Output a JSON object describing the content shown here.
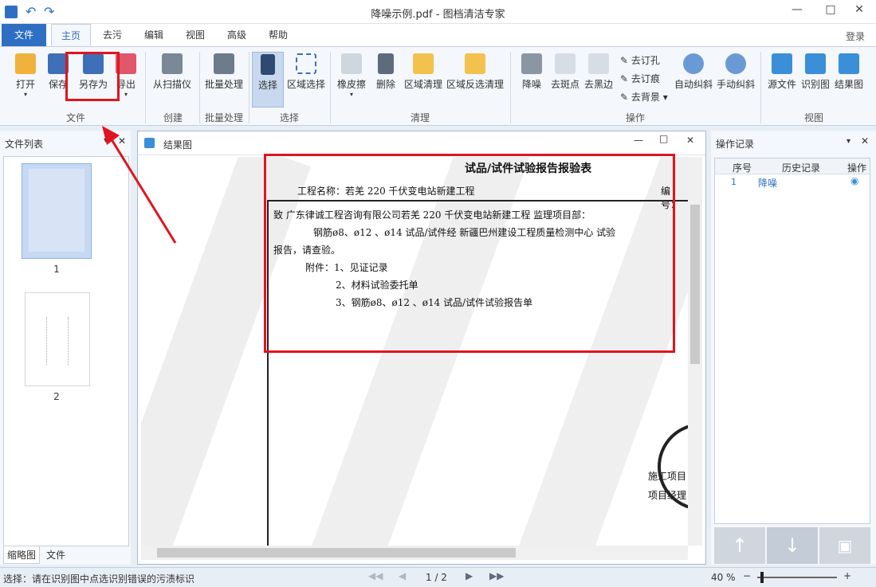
{
  "window": {
    "title": "降噪示例.pdf - 图档清洁专家"
  },
  "menu": {
    "tabs": [
      "文件",
      "主页",
      "去污",
      "编辑",
      "视图",
      "高级",
      "帮助"
    ],
    "login": "登录"
  },
  "ribbon": {
    "open": "打开",
    "save": "保存",
    "save_as": "另存为",
    "export": "导出",
    "scan": "从扫描仪",
    "batch": "批量处理",
    "select": "选择",
    "region_select": "区域选择",
    "eraser": "橡皮擦",
    "delete": "删除",
    "region_clean": "区域清理",
    "region_invert_clean": "区域反选清理",
    "denoise": "降噪",
    "remove_spots": "去斑点",
    "remove_black_edges": "去黑边",
    "remove_holes": "去订孔",
    "remove_marks": "去订痕",
    "remove_background": "去背景",
    "auto_deskew": "自动纠斜",
    "manual_deskew": "手动纠斜",
    "source_view": "源文件",
    "ocr_view": "识别图",
    "result_view": "结果图",
    "groups": {
      "file": "文件",
      "create": "创建",
      "batch": "批量处理",
      "select": "选择",
      "clean": "清理",
      "operate": "操作",
      "view": "视图"
    }
  },
  "left_panel": {
    "title": "文件列表",
    "pages": [
      "1",
      "2"
    ],
    "tabs": [
      "缩略图",
      "文件"
    ]
  },
  "doc": {
    "tab_title": "结果图",
    "heading": "试品/试件试验报告报验表",
    "project": "工程名称：若羌 220 千伏变电站新建工程",
    "number": "编号：",
    "lines": [
      "致 广东律诚工程咨询有限公司若羌 220 千伏变电站新建工程 监理项目部：",
      "钢筋ø8、ø12 、ø14 试品/试件经 新疆巴州建设工程质量检测中心 试验",
      "报告，请查验。",
      "附件：1、见证记录",
      "2、材料试验委托单",
      "3、钢筋ø8、ø12 、ø14 试品/试件试验报告单"
    ],
    "footer": [
      "施工项目",
      "项目经理"
    ]
  },
  "right_panel": {
    "title": "操作记录",
    "cols": [
      "序号",
      "历史记录",
      "操作"
    ],
    "rows": [
      {
        "no": "1",
        "record": "降噪"
      }
    ]
  },
  "status": {
    "text": "选择：请在识别图中点选识别错误的污渍标识",
    "page": "1 / 2",
    "zoom": "40 %"
  }
}
